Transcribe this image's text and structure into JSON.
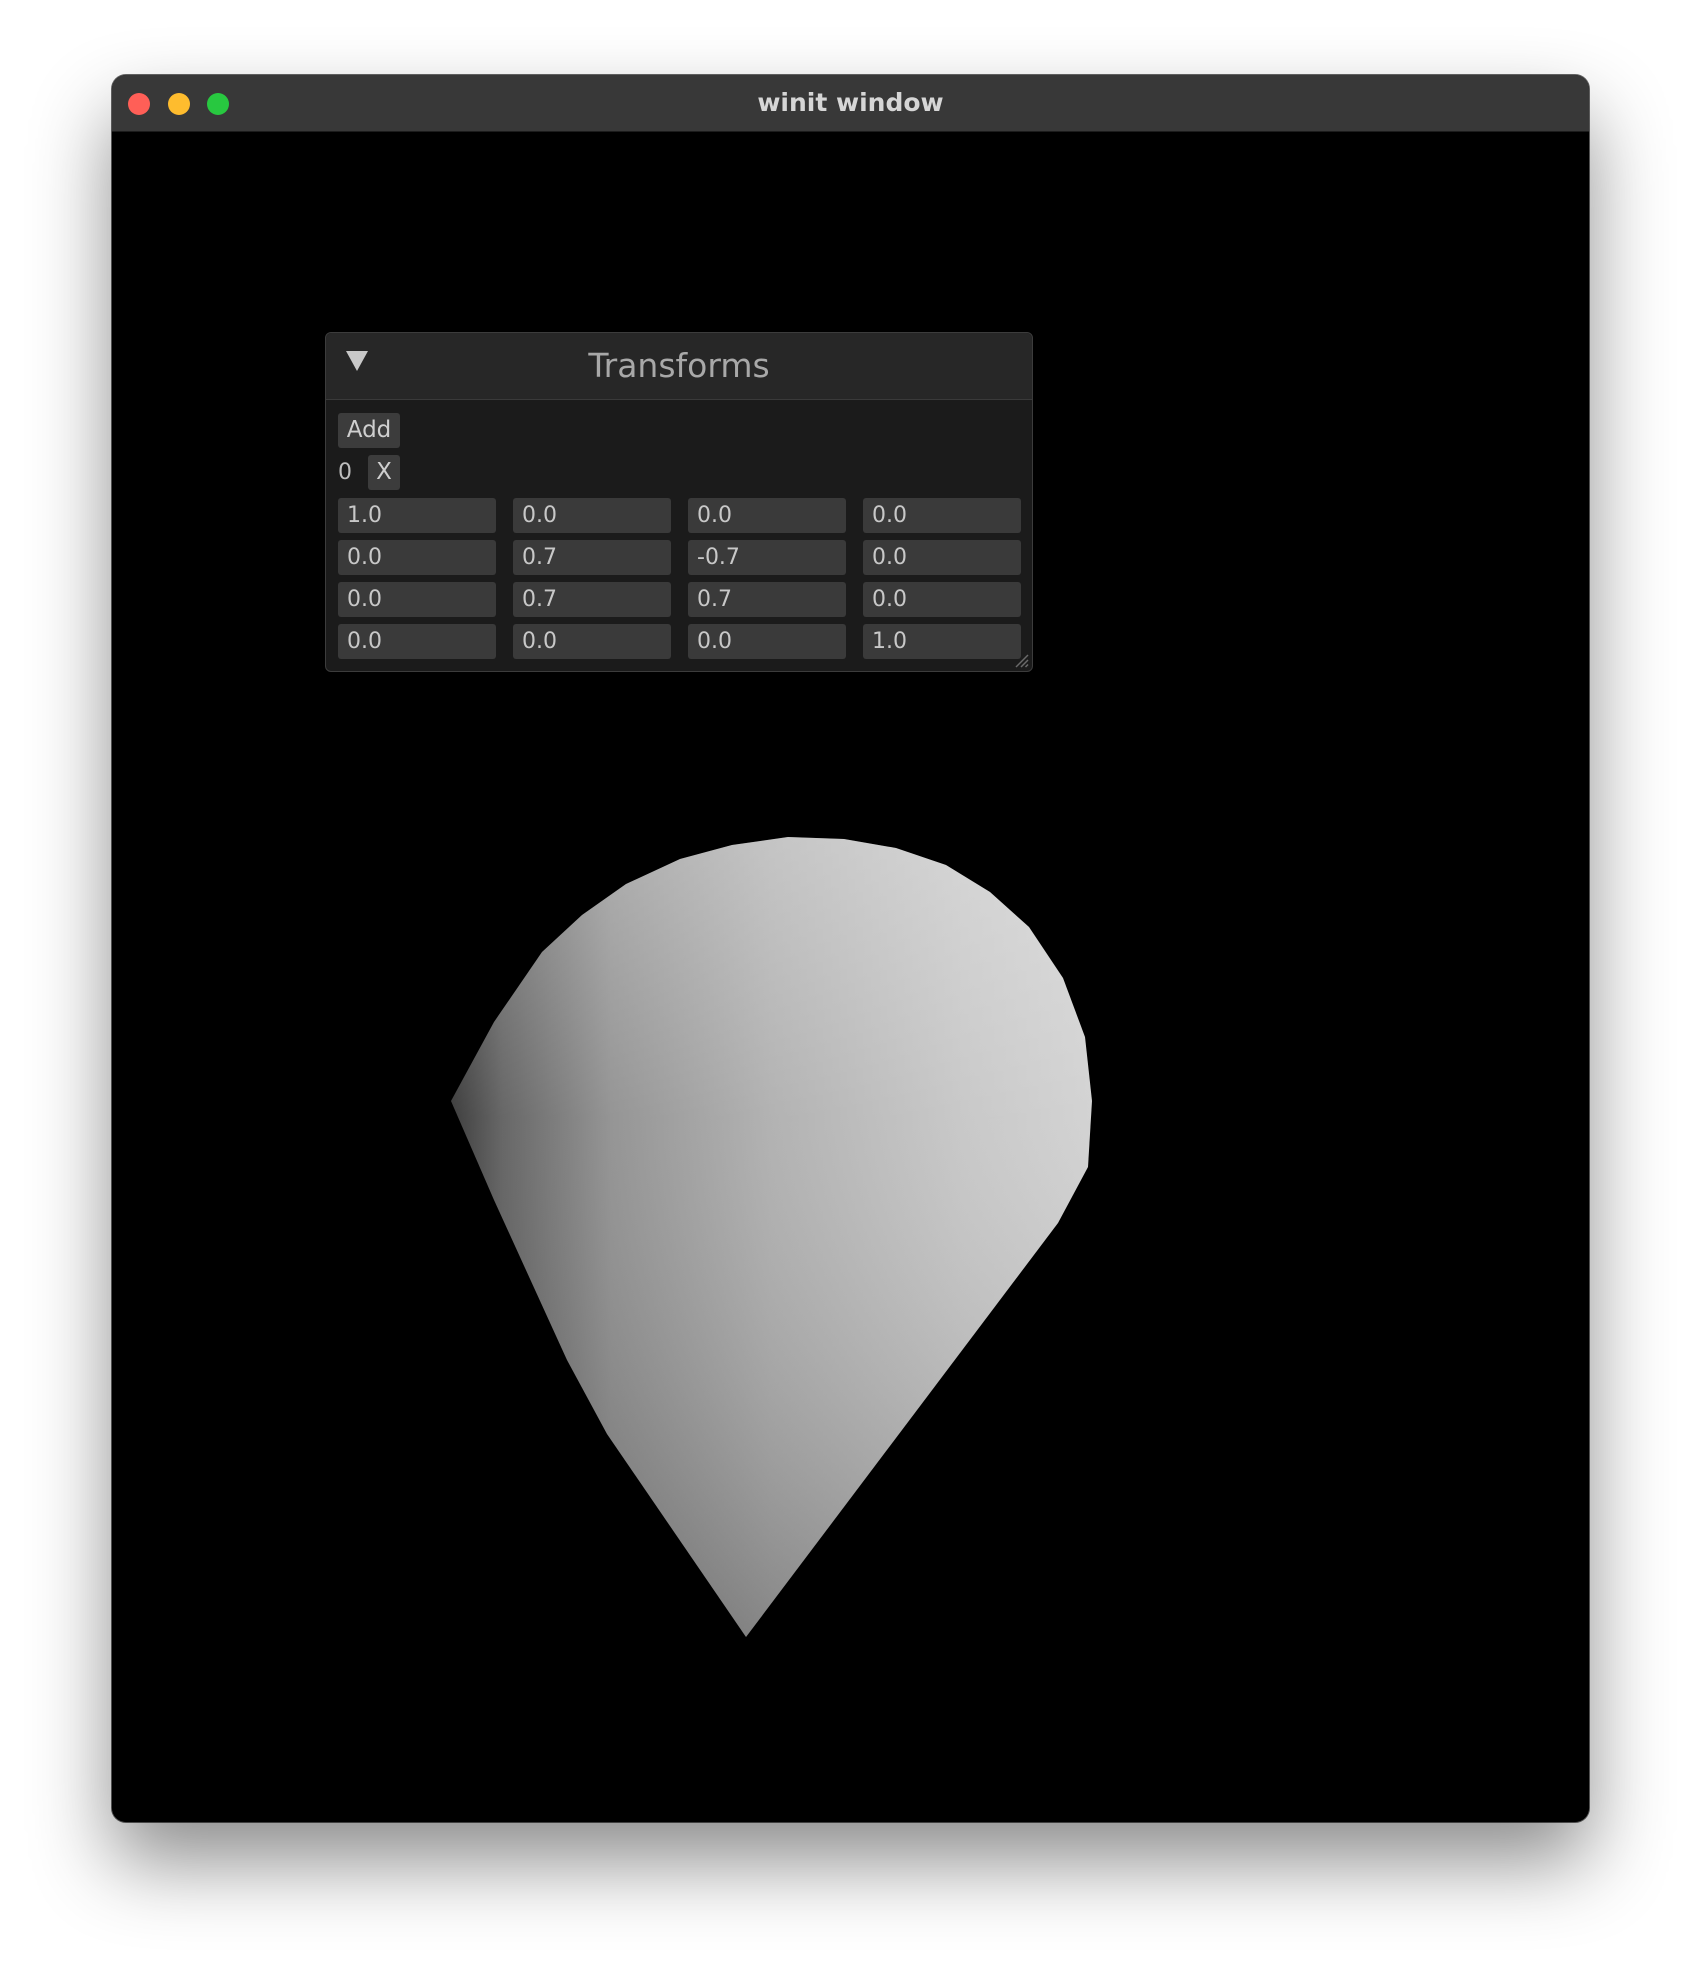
{
  "window": {
    "title": "winit window"
  },
  "panel": {
    "title": "Transforms",
    "add_label": "Add",
    "row_index": "0",
    "remove_label": "X",
    "matrix": [
      [
        "1.0",
        "0.0",
        "0.0",
        "0.0"
      ],
      [
        "0.0",
        "0.7",
        "-0.7",
        "0.0"
      ],
      [
        "0.0",
        "0.7",
        "0.7",
        "0.0"
      ],
      [
        "0.0",
        "0.0",
        "0.0",
        "1.0"
      ]
    ]
  },
  "colors": {
    "titlebar": "#383838",
    "panel_bg": "#1b1b1b",
    "field_bg": "#3a3a3a",
    "cone_light": "#dcdcdc",
    "cone_dark": "#3a3a3a"
  },
  "icons": {
    "collapse": "triangle-down-icon",
    "resize": "resize-grip-icon"
  }
}
